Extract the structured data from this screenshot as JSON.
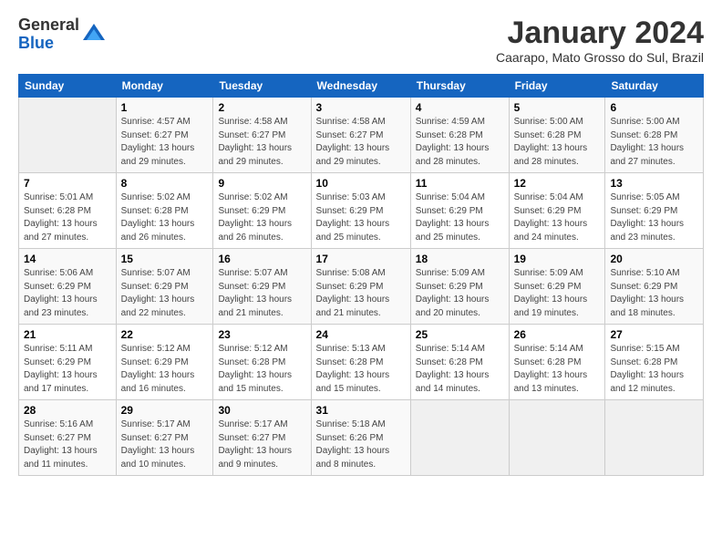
{
  "logo": {
    "general": "General",
    "blue": "Blue"
  },
  "title": "January 2024",
  "subtitle": "Caarapo, Mato Grosso do Sul, Brazil",
  "days_of_week": [
    "Sunday",
    "Monday",
    "Tuesday",
    "Wednesday",
    "Thursday",
    "Friday",
    "Saturday"
  ],
  "weeks": [
    [
      {
        "day": "",
        "info": ""
      },
      {
        "day": "1",
        "info": "Sunrise: 4:57 AM\nSunset: 6:27 PM\nDaylight: 13 hours\nand 29 minutes."
      },
      {
        "day": "2",
        "info": "Sunrise: 4:58 AM\nSunset: 6:27 PM\nDaylight: 13 hours\nand 29 minutes."
      },
      {
        "day": "3",
        "info": "Sunrise: 4:58 AM\nSunset: 6:27 PM\nDaylight: 13 hours\nand 29 minutes."
      },
      {
        "day": "4",
        "info": "Sunrise: 4:59 AM\nSunset: 6:28 PM\nDaylight: 13 hours\nand 28 minutes."
      },
      {
        "day": "5",
        "info": "Sunrise: 5:00 AM\nSunset: 6:28 PM\nDaylight: 13 hours\nand 28 minutes."
      },
      {
        "day": "6",
        "info": "Sunrise: 5:00 AM\nSunset: 6:28 PM\nDaylight: 13 hours\nand 27 minutes."
      }
    ],
    [
      {
        "day": "7",
        "info": "Sunrise: 5:01 AM\nSunset: 6:28 PM\nDaylight: 13 hours\nand 27 minutes."
      },
      {
        "day": "8",
        "info": "Sunrise: 5:02 AM\nSunset: 6:28 PM\nDaylight: 13 hours\nand 26 minutes."
      },
      {
        "day": "9",
        "info": "Sunrise: 5:02 AM\nSunset: 6:29 PM\nDaylight: 13 hours\nand 26 minutes."
      },
      {
        "day": "10",
        "info": "Sunrise: 5:03 AM\nSunset: 6:29 PM\nDaylight: 13 hours\nand 25 minutes."
      },
      {
        "day": "11",
        "info": "Sunrise: 5:04 AM\nSunset: 6:29 PM\nDaylight: 13 hours\nand 25 minutes."
      },
      {
        "day": "12",
        "info": "Sunrise: 5:04 AM\nSunset: 6:29 PM\nDaylight: 13 hours\nand 24 minutes."
      },
      {
        "day": "13",
        "info": "Sunrise: 5:05 AM\nSunset: 6:29 PM\nDaylight: 13 hours\nand 23 minutes."
      }
    ],
    [
      {
        "day": "14",
        "info": "Sunrise: 5:06 AM\nSunset: 6:29 PM\nDaylight: 13 hours\nand 23 minutes."
      },
      {
        "day": "15",
        "info": "Sunrise: 5:07 AM\nSunset: 6:29 PM\nDaylight: 13 hours\nand 22 minutes."
      },
      {
        "day": "16",
        "info": "Sunrise: 5:07 AM\nSunset: 6:29 PM\nDaylight: 13 hours\nand 21 minutes."
      },
      {
        "day": "17",
        "info": "Sunrise: 5:08 AM\nSunset: 6:29 PM\nDaylight: 13 hours\nand 21 minutes."
      },
      {
        "day": "18",
        "info": "Sunrise: 5:09 AM\nSunset: 6:29 PM\nDaylight: 13 hours\nand 20 minutes."
      },
      {
        "day": "19",
        "info": "Sunrise: 5:09 AM\nSunset: 6:29 PM\nDaylight: 13 hours\nand 19 minutes."
      },
      {
        "day": "20",
        "info": "Sunrise: 5:10 AM\nSunset: 6:29 PM\nDaylight: 13 hours\nand 18 minutes."
      }
    ],
    [
      {
        "day": "21",
        "info": "Sunrise: 5:11 AM\nSunset: 6:29 PM\nDaylight: 13 hours\nand 17 minutes."
      },
      {
        "day": "22",
        "info": "Sunrise: 5:12 AM\nSunset: 6:29 PM\nDaylight: 13 hours\nand 16 minutes."
      },
      {
        "day": "23",
        "info": "Sunrise: 5:12 AM\nSunset: 6:28 PM\nDaylight: 13 hours\nand 15 minutes."
      },
      {
        "day": "24",
        "info": "Sunrise: 5:13 AM\nSunset: 6:28 PM\nDaylight: 13 hours\nand 15 minutes."
      },
      {
        "day": "25",
        "info": "Sunrise: 5:14 AM\nSunset: 6:28 PM\nDaylight: 13 hours\nand 14 minutes."
      },
      {
        "day": "26",
        "info": "Sunrise: 5:14 AM\nSunset: 6:28 PM\nDaylight: 13 hours\nand 13 minutes."
      },
      {
        "day": "27",
        "info": "Sunrise: 5:15 AM\nSunset: 6:28 PM\nDaylight: 13 hours\nand 12 minutes."
      }
    ],
    [
      {
        "day": "28",
        "info": "Sunrise: 5:16 AM\nSunset: 6:27 PM\nDaylight: 13 hours\nand 11 minutes."
      },
      {
        "day": "29",
        "info": "Sunrise: 5:17 AM\nSunset: 6:27 PM\nDaylight: 13 hours\nand 10 minutes."
      },
      {
        "day": "30",
        "info": "Sunrise: 5:17 AM\nSunset: 6:27 PM\nDaylight: 13 hours\nand 9 minutes."
      },
      {
        "day": "31",
        "info": "Sunrise: 5:18 AM\nSunset: 6:26 PM\nDaylight: 13 hours\nand 8 minutes."
      },
      {
        "day": "",
        "info": ""
      },
      {
        "day": "",
        "info": ""
      },
      {
        "day": "",
        "info": ""
      }
    ]
  ]
}
